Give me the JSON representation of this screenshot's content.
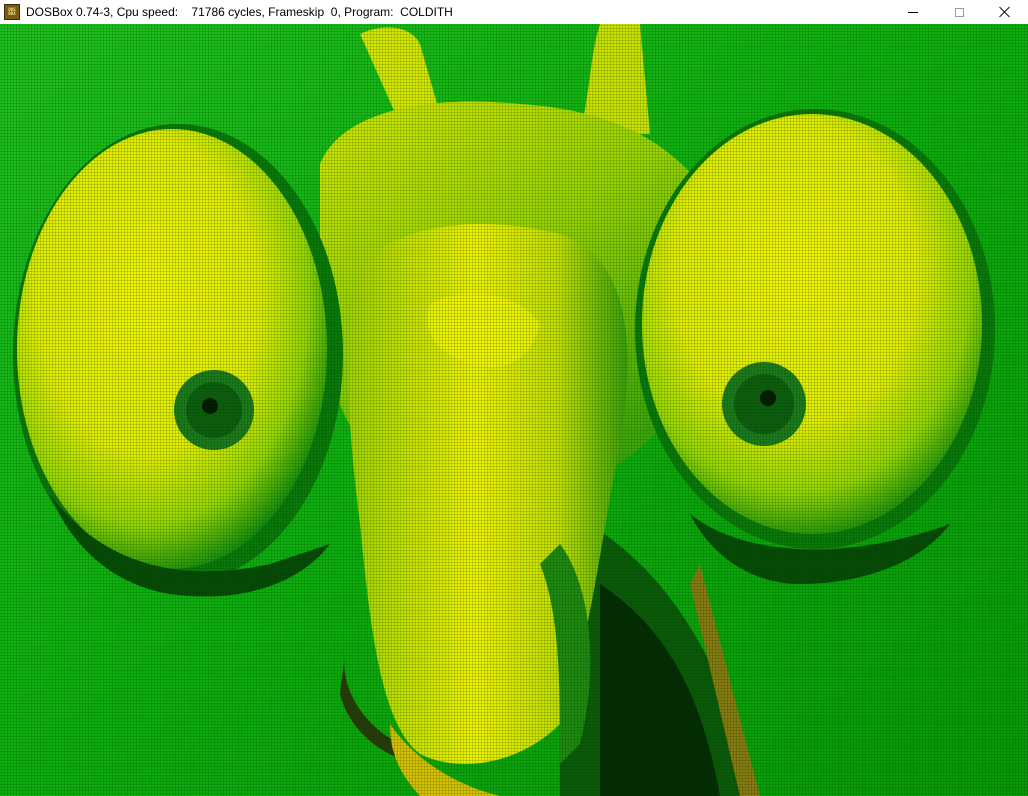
{
  "window": {
    "title": "DOSBox 0.74-3, Cpu speed:    71786 cycles, Frameskip  0, Program:  COLDITH",
    "icon": {
      "name": "dosbox-icon",
      "text_top": "DOS",
      "text_bottom": "BOX"
    },
    "controls": {
      "minimize": "minimize-icon",
      "maximize": "maximize-icon",
      "close": "close-icon"
    }
  },
  "screen": {
    "content": "dithered image of a praying mantis face",
    "palette": {
      "background": "#0cb40c",
      "bright": "#f0f000",
      "mid": "#6cc800",
      "dark": "#0a6a0a",
      "shadow": "#042a04"
    }
  }
}
